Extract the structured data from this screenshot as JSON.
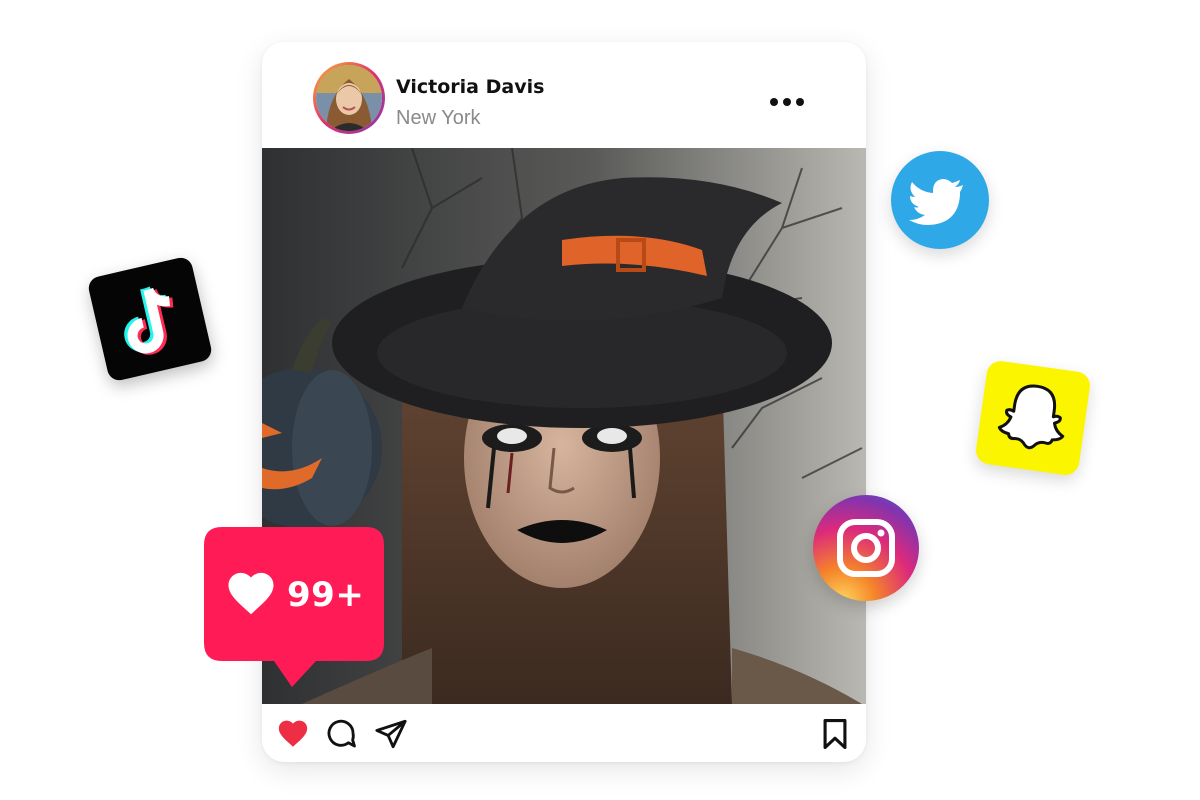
{
  "post": {
    "user": {
      "name": "Victoria Davis",
      "location": "New York"
    },
    "more_icon": "more-horizontal-icon",
    "image_icon": "post-photo",
    "actions": {
      "like_icon": "heart-filled-icon",
      "comment_icon": "comment-icon",
      "share_icon": "send-icon",
      "save_icon": "bookmark-icon",
      "like_color": "#ed2e45"
    }
  },
  "like_notification": {
    "count": "99+",
    "icon": "heart-icon",
    "color": "#ff1c56"
  },
  "social_icons": [
    {
      "name": "TikTok",
      "icon": "tiktok-icon"
    },
    {
      "name": "Twitter",
      "icon": "twitter-icon",
      "color": "#2fa8e8"
    },
    {
      "name": "Snapchat",
      "icon": "snapchat-icon",
      "color": "#fbf500"
    },
    {
      "name": "Instagram",
      "icon": "instagram-icon"
    }
  ]
}
